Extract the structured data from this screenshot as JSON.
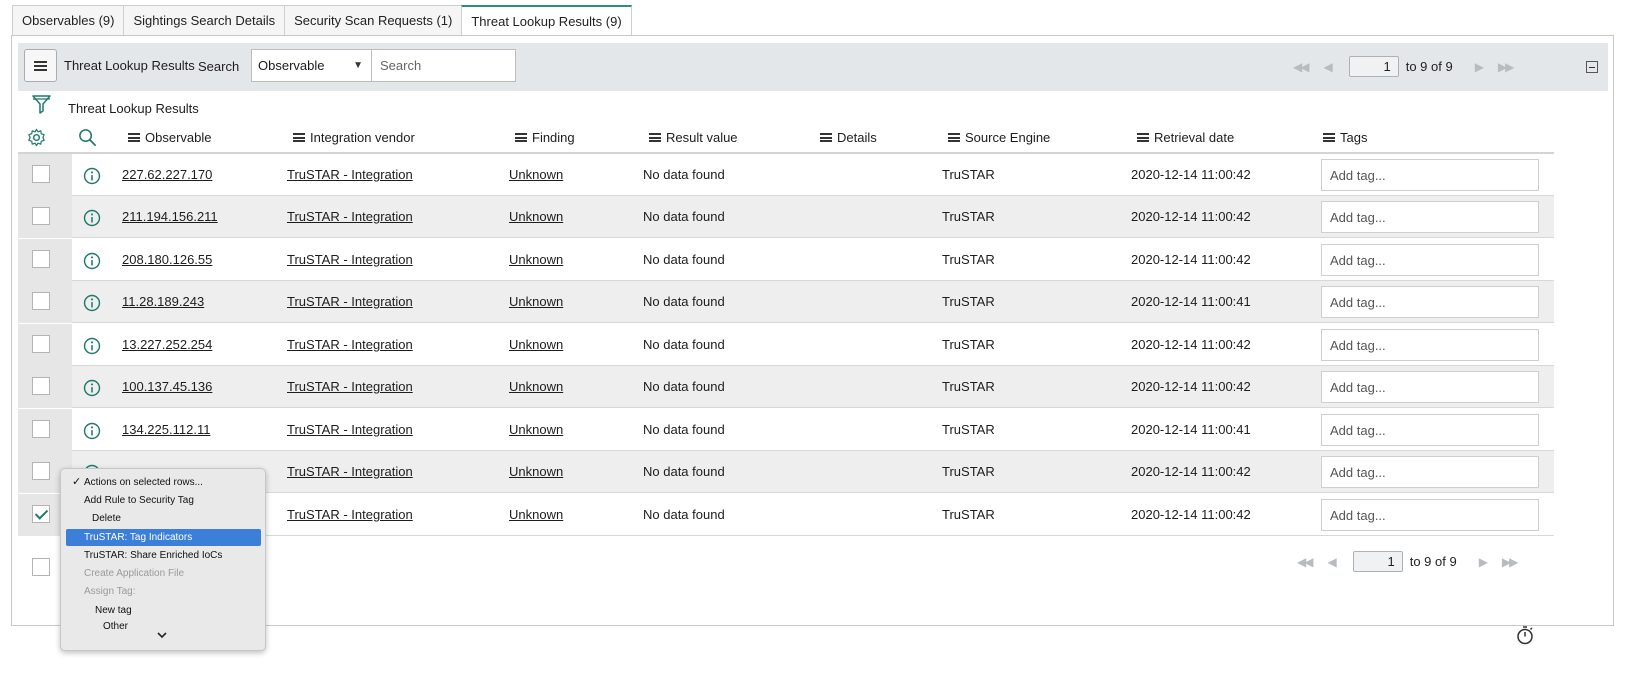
{
  "tabs": [
    {
      "label": "Observables (9)"
    },
    {
      "label": "Sightings Search Details"
    },
    {
      "label": "Security Scan Requests (1)"
    },
    {
      "label": "Threat Lookup Results (9)"
    }
  ],
  "toolbar": {
    "title": "Threat Lookup Results",
    "search_label": "Search",
    "search_field": "Observable",
    "search_placeholder": "Search"
  },
  "pager_top": {
    "page": "1",
    "total": "to 9 of 9"
  },
  "pager_bottom": {
    "page": "1",
    "total": "to 9 of 9"
  },
  "list_title": "Threat Lookup Results",
  "columns": [
    {
      "label": "Observable"
    },
    {
      "label": "Integration vendor"
    },
    {
      "label": "Finding"
    },
    {
      "label": "Result value"
    },
    {
      "label": "Details"
    },
    {
      "label": "Source Engine"
    },
    {
      "label": "Retrieval date"
    },
    {
      "label": "Tags"
    }
  ],
  "rows": [
    {
      "observable": "227.62.227.170",
      "vendor": "TruSTAR - Integration",
      "finding": "Unknown",
      "result": "No data found",
      "details": "",
      "engine": "TruSTAR",
      "date": "2020-12-14 11:00:42",
      "checked": false
    },
    {
      "observable": "211.194.156.211",
      "vendor": "TruSTAR - Integration",
      "finding": "Unknown",
      "result": "No data found",
      "details": "",
      "engine": "TruSTAR",
      "date": "2020-12-14 11:00:42",
      "checked": false
    },
    {
      "observable": "208.180.126.55",
      "vendor": "TruSTAR - Integration",
      "finding": "Unknown",
      "result": "No data found",
      "details": "",
      "engine": "TruSTAR",
      "date": "2020-12-14 11:00:42",
      "checked": false
    },
    {
      "observable": "11.28.189.243",
      "vendor": "TruSTAR - Integration",
      "finding": "Unknown",
      "result": "No data found",
      "details": "",
      "engine": "TruSTAR",
      "date": "2020-12-14 11:00:41",
      "checked": false
    },
    {
      "observable": "13.227.252.254",
      "vendor": "TruSTAR - Integration",
      "finding": "Unknown",
      "result": "No data found",
      "details": "",
      "engine": "TruSTAR",
      "date": "2020-12-14 11:00:42",
      "checked": false
    },
    {
      "observable": "100.137.45.136",
      "vendor": "TruSTAR - Integration",
      "finding": "Unknown",
      "result": "No data found",
      "details": "",
      "engine": "TruSTAR",
      "date": "2020-12-14 11:00:42",
      "checked": false
    },
    {
      "observable": "134.225.112.11",
      "vendor": "TruSTAR - Integration",
      "finding": "Unknown",
      "result": "No data found",
      "details": "",
      "engine": "TruSTAR",
      "date": "2020-12-14 11:00:41",
      "checked": false
    },
    {
      "observable": "",
      "vendor": "TruSTAR - Integration",
      "finding": "Unknown",
      "result": "No data found",
      "details": "",
      "engine": "TruSTAR",
      "date": "2020-12-14 11:00:42",
      "checked": false
    },
    {
      "observable": "",
      "vendor": "TruSTAR - Integration",
      "finding": "Unknown",
      "result": "No data found",
      "details": "",
      "engine": "TruSTAR",
      "date": "2020-12-14 11:00:42",
      "checked": true
    }
  ],
  "tag_placeholder": "Add tag...",
  "actions_menu": {
    "items": [
      {
        "label": "Actions on selected rows...",
        "state": "checked"
      },
      {
        "label": "Add Rule to Security Tag",
        "state": "enabled"
      },
      {
        "label": "Delete",
        "state": "enabled"
      },
      {
        "label": "TruSTAR: Tag Indicators",
        "state": "selected"
      },
      {
        "label": "TruSTAR: Share Enriched IoCs",
        "state": "enabled"
      },
      {
        "label": "Create Application File",
        "state": "disabled"
      },
      {
        "label": "Assign Tag:",
        "state": "disabled"
      },
      {
        "label": "New tag",
        "state": "enabled"
      },
      {
        "label": "Other",
        "state": "enabled"
      }
    ]
  },
  "icons": {
    "menu": "hamburger-icon",
    "filter": "filter-icon",
    "settings": "gear-icon",
    "search": "magnifier-icon",
    "info": "info-circle-icon",
    "timer": "stopwatch-icon"
  },
  "colors": {
    "accent": "#1f7a6d",
    "menu_selected": "#3b7fd8",
    "toolbar_bg": "#e4e7ea",
    "row_alt": "#eeeeee"
  }
}
